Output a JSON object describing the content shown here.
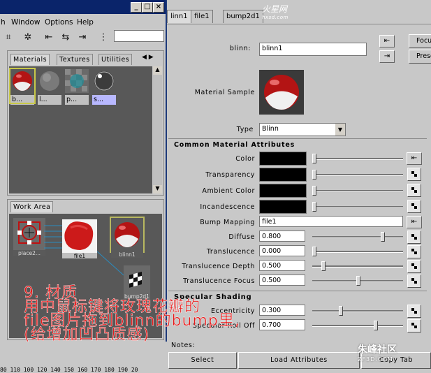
{
  "hypershade": {
    "menu": [
      "h",
      "Window",
      "Options",
      "Help"
    ],
    "window_buttons": [
      "_",
      "□",
      "×"
    ],
    "top_tabs": [
      "Materials",
      "Textures",
      "Utilities"
    ],
    "swatches": [
      {
        "label": "b..."
      },
      {
        "label": "l..."
      },
      {
        "label": "p..."
      },
      {
        "label": "s..."
      }
    ],
    "work_area_tab": "Work Area",
    "nodes": {
      "place2d": "place2...",
      "file": "file1",
      "blinn": "blinn1",
      "bump": "bump2d1"
    },
    "ruler": "80 110 100 120 140 150 160 170 180 190 20"
  },
  "attribute_editor": {
    "tabs": [
      "linn1",
      "file1",
      "bump2d1"
    ],
    "focus_label": "Focu",
    "presets_label": "Prese",
    "name_label": "blinn:",
    "name_value": "blinn1",
    "material_sample_label": "Material Sample",
    "type_label": "Type",
    "type_value": "Blinn",
    "common_section": "Common Material Attributes",
    "color_label": "Color",
    "transparency_label": "Transparency",
    "ambient_label": "Ambient Color",
    "incandescence_label": "Incandescence",
    "bump_label": "Bump Mapping",
    "bump_value": "file1",
    "diffuse_label": "Diffuse",
    "diffuse_value": "0.800",
    "translucence_label": "Translucence",
    "translucence_value": "0.000",
    "depth_label": "Translucence Depth",
    "depth_value": "0.500",
    "focus_attr_label": "Translucence Focus",
    "focus_attr_value": "0.500",
    "specular_section": "Specular Shading",
    "eccentricity_label": "Eccentricity",
    "eccentricity_value": "0.300",
    "rolloff_label": "Specular Roll Off",
    "rolloff_value": "0.700",
    "notes_label": "Notes:",
    "select_button": "Select",
    "load_button": "Load Attributes",
    "copy_button": "Copy Tab",
    "logo_text": "火星网",
    "logo_sub": "hxsd.com"
  },
  "overlay": {
    "line1": "9. 材质",
    "line2": "用中鼠标键将玫瑰花瓣的",
    "line3": "file图片拖到blinn的bump里,",
    "line4": "(给增加凹凸质感)"
  },
  "watermark": {
    "title": "朱峰社区",
    "sub": "ZF3D.COM"
  },
  "colors": {
    "title_bar": "#0a246a",
    "panel_bg": "#c8c8c8",
    "dark_area": "#585858",
    "overlay_text": "#e51a1a"
  }
}
